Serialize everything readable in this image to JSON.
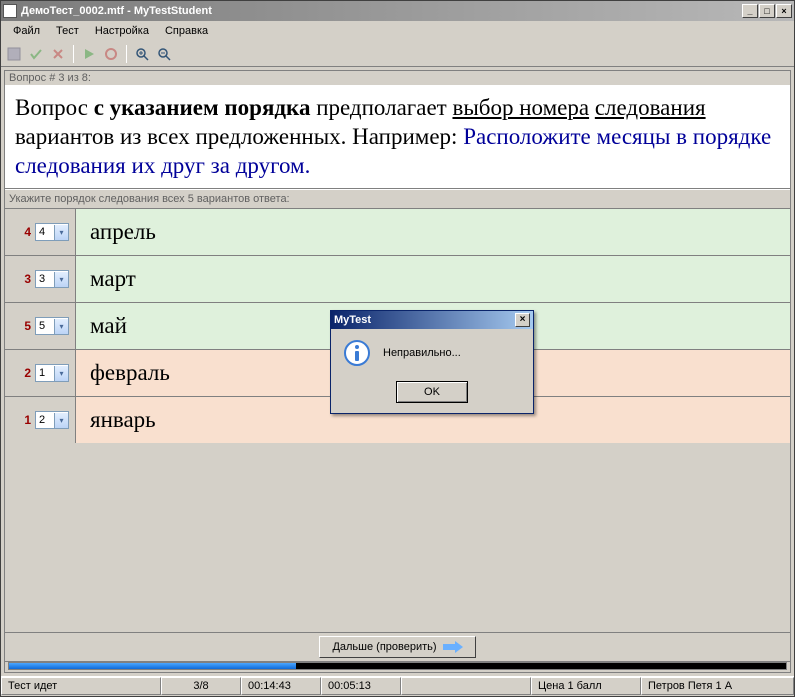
{
  "title": "ДемоТест_0002.mtf - MyTestStudent",
  "menu": {
    "file": "Файл",
    "test": "Тест",
    "settings": "Настройка",
    "help": "Справка"
  },
  "content": {
    "q_header": "Вопрос # 3 из 8:",
    "q_text_prefix": "Вопрос ",
    "q_text_bold": "с указанием порядка",
    "q_text_mid1": " предполагает ",
    "q_text_u1": "выбор номера",
    "q_text_u2": "следования",
    "q_text_suffix1": " вариантов из всех предложенных. Например: ",
    "q_prompt": "Расположите месяцы в порядке следования их друг за другом.",
    "hint": "Укажите порядок следования всех 5 вариантов ответа:",
    "answers": [
      {
        "num": "4",
        "sel": "4",
        "text": "апрель",
        "color": "green"
      },
      {
        "num": "3",
        "sel": "3",
        "text": "март",
        "color": "green"
      },
      {
        "num": "5",
        "sel": "5",
        "text": "май",
        "color": "green"
      },
      {
        "num": "2",
        "sel": "1",
        "text": "февраль",
        "color": "pink"
      },
      {
        "num": "1",
        "sel": "2",
        "text": "январь",
        "color": "pink"
      }
    ],
    "next_label": "Дальше (проверить)"
  },
  "dialog": {
    "title": "MyTest",
    "message": "Неправильно...",
    "ok": "OK"
  },
  "status": {
    "state": "Тест идет",
    "pos": "3/8",
    "t1": "00:14:43",
    "t2": "00:05:13",
    "price": "Цена 1 балл",
    "user": "Петров Петя 1 А"
  }
}
